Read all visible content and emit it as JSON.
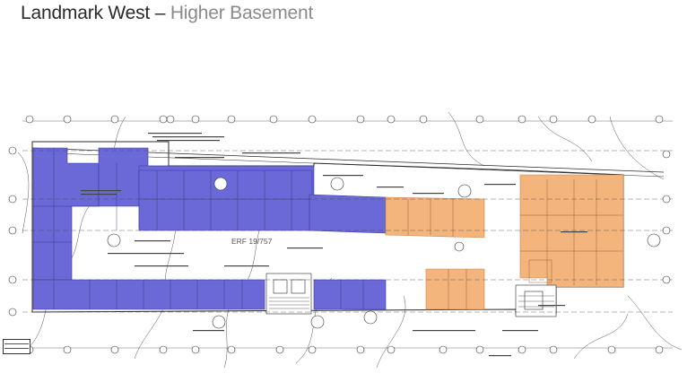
{
  "title": {
    "main": "Landmark West",
    "dash": "–",
    "sub": "Higher Basement"
  },
  "plan": {
    "erf_label": "ERF 19/757",
    "colors": {
      "area_blue": "#6b69d8",
      "area_orange": "#f4b57d",
      "line": "#2b2b2b",
      "bg": "#ffffff"
    }
  }
}
